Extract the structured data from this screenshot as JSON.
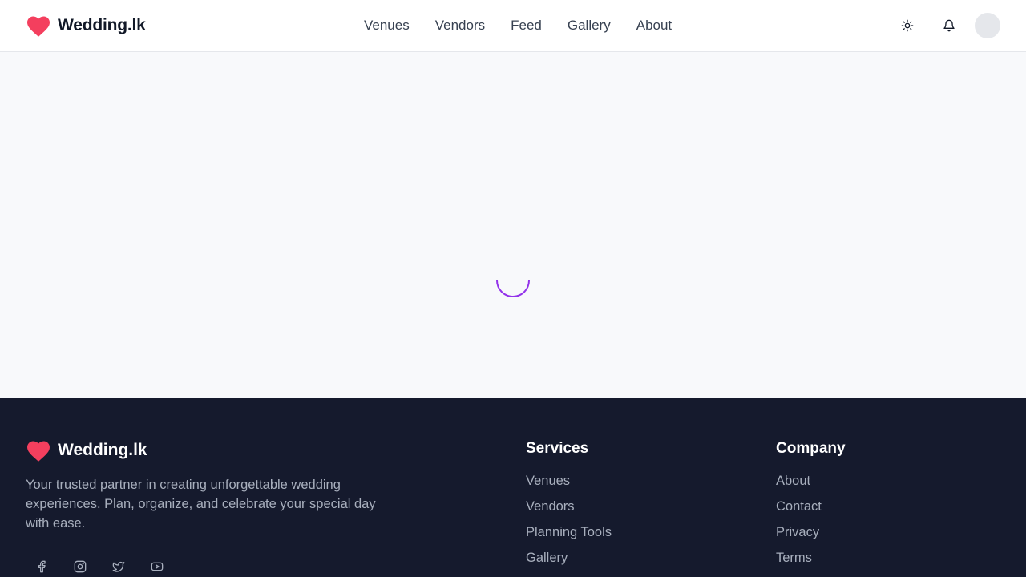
{
  "brand": {
    "name": "Wedding.lk",
    "accent_color": "#f43f5e"
  },
  "nav": {
    "items": [
      {
        "label": "Venues"
      },
      {
        "label": "Vendors"
      },
      {
        "label": "Feed"
      },
      {
        "label": "Gallery"
      },
      {
        "label": "About"
      }
    ]
  },
  "header_actions": {
    "icons": [
      "sun-icon",
      "bell-icon"
    ]
  },
  "loading": {
    "spinner_color": "#9333ea"
  },
  "footer": {
    "brand_name": "Wedding.lk",
    "description": "Your trusted partner in creating unforgettable wedding experiences. Plan, organize, and celebrate your special day with ease.",
    "socials": [
      "facebook-icon",
      "instagram-icon",
      "twitter-icon",
      "youtube-icon"
    ],
    "services": {
      "title": "Services",
      "links": [
        {
          "label": "Venues"
        },
        {
          "label": "Vendors"
        },
        {
          "label": "Planning Tools"
        },
        {
          "label": "Gallery"
        }
      ]
    },
    "company": {
      "title": "Company",
      "links": [
        {
          "label": "About"
        },
        {
          "label": "Contact"
        },
        {
          "label": "Privacy"
        },
        {
          "label": "Terms"
        }
      ]
    }
  }
}
